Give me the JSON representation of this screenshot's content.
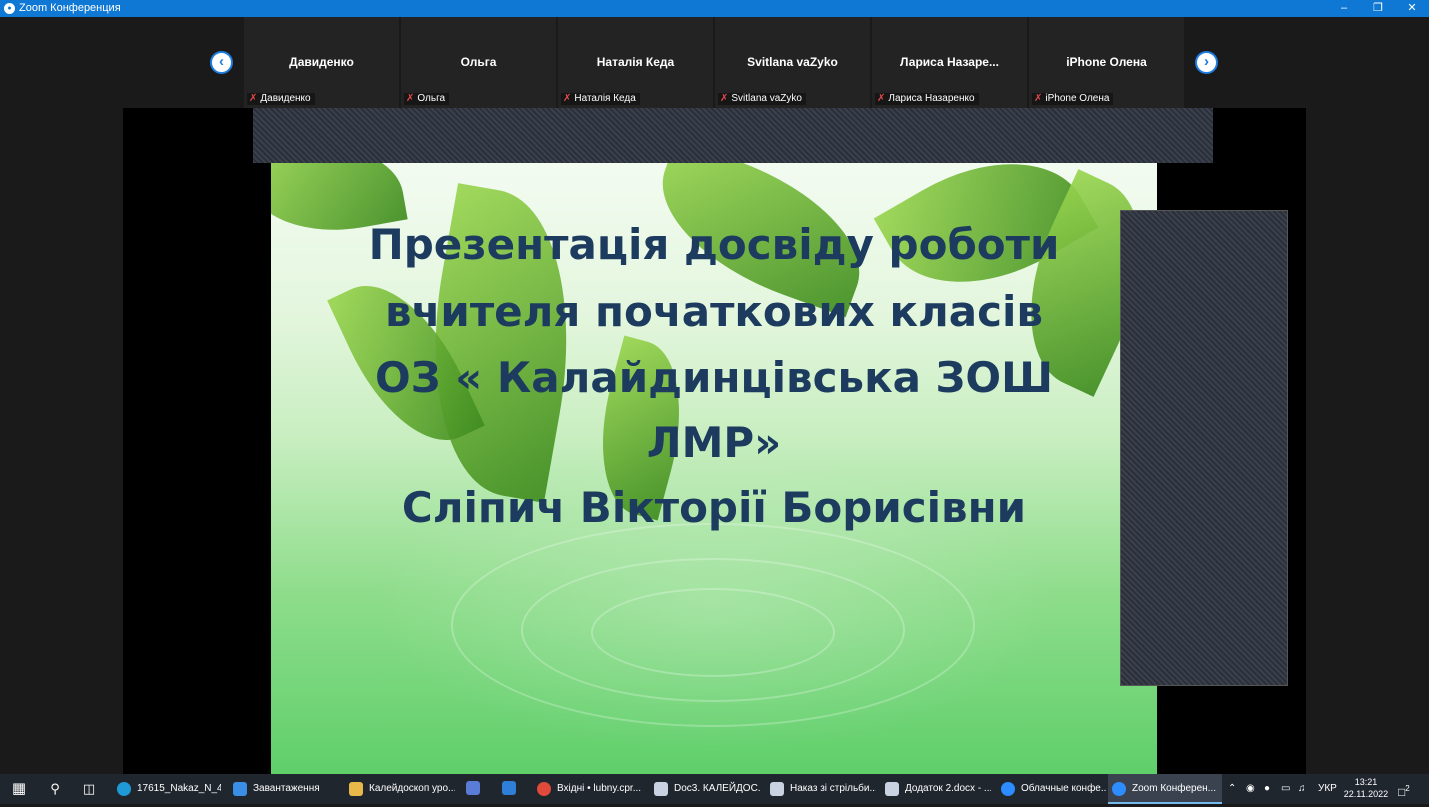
{
  "window": {
    "app_icon": "zoom-logo-icon",
    "title": "Zoom Конференция",
    "controls": [
      "minimize-icon",
      "maximize-icon",
      "close-icon"
    ]
  },
  "participants": [
    {
      "name": "Давиденко",
      "caption": "Давиденко",
      "muted": true
    },
    {
      "name": "Ольга",
      "caption": "Ольга",
      "muted": true
    },
    {
      "name": "Наталія Кеда",
      "caption": "Наталія Кеда",
      "muted": true
    },
    {
      "name": "Svitlana vaZyko",
      "caption": "Svitlana vaZyko",
      "muted": true
    },
    {
      "name": "Лариса  Назаре...",
      "caption": "Лариса Назаренко",
      "muted": true
    },
    {
      "name": "iPhone Олена",
      "caption": "iPhone Олена",
      "muted": true
    }
  ],
  "slide": {
    "lines": [
      "Презентація досвіду роботи",
      "вчителя початкових класів",
      "ОЗ « Калайдинцівська ЗОШ",
      "ЛМР»",
      "Сліпич  Вікторії Борисівни"
    ]
  },
  "taskbar": {
    "items": [
      {
        "label": "17615_Nakaz_N_45...",
        "icon": "edge-icon",
        "color": "#1f9ad6"
      },
      {
        "label": "Завантаження",
        "icon": "download-icon",
        "color": "#3a8ee6"
      },
      {
        "label": "Калейдоскоп уро...",
        "icon": "folder-icon",
        "color": "#e8b84a"
      },
      {
        "label": "",
        "icon": "store-icon",
        "color": "#5a7bd6"
      },
      {
        "label": "",
        "icon": "mail-icon",
        "color": "#2f7fd8"
      },
      {
        "label": "Вхідні • lubny.cpr...",
        "icon": "chrome-icon",
        "color": "#e04a3a"
      },
      {
        "label": "Doc3. КАЛЕЙДОС...",
        "icon": "document-icon",
        "color": "#c9d2e0"
      },
      {
        "label": "Наказ зі стрільби...",
        "icon": "document-icon",
        "color": "#c9d2e0"
      },
      {
        "label": "Додаток 2.docx - ...",
        "icon": "document-icon",
        "color": "#c9d2e0"
      },
      {
        "label": "Облачные конфе...",
        "icon": "zoom-icon",
        "color": "#2d8cff"
      },
      {
        "label": "Zoom Конферен...",
        "icon": "zoom-icon",
        "color": "#2d8cff",
        "active": true
      }
    ],
    "language": "УКР",
    "time": "13:21",
    "date": "22.11.2022",
    "notification_count": "2"
  }
}
